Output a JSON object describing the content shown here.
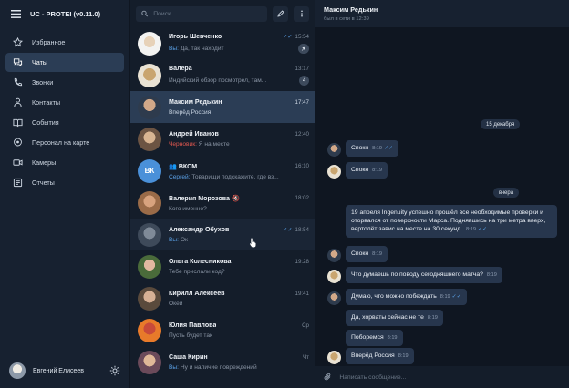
{
  "app": {
    "title": "UC - PROTEI (v0.11.0)"
  },
  "sidebar": {
    "items": [
      {
        "label": "Избранное",
        "icon": "star-icon",
        "active": false
      },
      {
        "label": "Чаты",
        "icon": "chat-icon",
        "active": true
      },
      {
        "label": "Звонки",
        "icon": "phone-icon",
        "active": false
      },
      {
        "label": "Контакты",
        "icon": "person-icon",
        "active": false
      },
      {
        "label": "События",
        "icon": "book-icon",
        "active": false
      },
      {
        "label": "Персонал на карте",
        "icon": "map-pin-icon",
        "active": false
      },
      {
        "label": "Камеры",
        "icon": "camera-icon",
        "active": false
      },
      {
        "label": "Отчеты",
        "icon": "report-icon",
        "active": false
      }
    ],
    "user": {
      "name": "Евгений Елисеев"
    }
  },
  "chatlist": {
    "search_placeholder": "Поиск",
    "chats": [
      {
        "name": "Игорь Шевченко",
        "time": "15:54",
        "prefix": "Вы:",
        "preview": "Да, так находит",
        "badge": "pin",
        "read": true
      },
      {
        "name": "Валера",
        "time": "13:17",
        "prefix": "",
        "preview": "Индийский обзор посмотрел, там...",
        "badge": "4",
        "read": false
      },
      {
        "name": "Максим Редькин",
        "time": "17:47",
        "prefix": "",
        "preview": "Вперёд Россия",
        "badge": "",
        "read": false
      },
      {
        "name": "Андрей Иванов",
        "time": "12:40",
        "prefix": "Черновик:",
        "preview": "Я на месте",
        "badge": "",
        "read": false
      },
      {
        "name": "ВКСМ",
        "time": "16:10",
        "prefix": "Сергей:",
        "preview": "Товарищи подскажите, где вз...",
        "badge": "",
        "read": false
      },
      {
        "name": "Валерия Морозова",
        "time": "18:02",
        "prefix": "",
        "preview": "Кого именно?",
        "badge": "",
        "read": false
      },
      {
        "name": "Александр Обухов",
        "time": "18:54",
        "prefix": "Вы:",
        "preview": "Ок",
        "badge": "",
        "read": true
      },
      {
        "name": "Ольга Колесникова",
        "time": "19:28",
        "prefix": "",
        "preview": "Тебе прислали код?",
        "badge": "",
        "read": false
      },
      {
        "name": "Кирилл Алексеев",
        "time": "19:41",
        "prefix": "",
        "preview": "Окей",
        "badge": "",
        "read": false
      },
      {
        "name": "Юлия Павлова",
        "time": "Ср",
        "prefix": "",
        "preview": "Пусть будет так",
        "badge": "",
        "read": false
      },
      {
        "name": "Саша Кирин",
        "time": "Чт",
        "prefix": "Вы:",
        "preview": "Ну и наличие повреждений",
        "badge": "",
        "read": false
      }
    ],
    "group_avatar_text": "ВК"
  },
  "conversation": {
    "name": "Максим Редькин",
    "status": "был в сети в 12:39",
    "dates": [
      "15 декабря",
      "вчера"
    ],
    "messages": [
      {
        "text": "Спокн",
        "time": "8:19",
        "read": true,
        "avatar": "a"
      },
      {
        "text": "Спокн",
        "time": "8:19",
        "read": false,
        "avatar": "b"
      },
      {
        "text": "19 апреля Ingenuity успешно прошёл все необходимые проверки и оторвался от поверхности Марса. Поднявшись на три метра вверх, вертолёт завис на месте на 30 секунд.",
        "time": "8:19",
        "read": true,
        "avatar": ""
      },
      {
        "text": "Спокн",
        "time": "8:19",
        "read": false,
        "avatar": "a"
      },
      {
        "text": "Что думаешь по поводу сегодняшнего матча?",
        "time": "8:19",
        "read": false,
        "avatar": "b"
      },
      {
        "text": "Думаю, что можно побеждать",
        "time": "8:19",
        "read": true,
        "avatar": "a"
      },
      {
        "text": "Да, хорваты сейчас не те",
        "time": "8:19",
        "read": false,
        "avatar": ""
      },
      {
        "text": "Поборемся",
        "time": "8:19",
        "read": false,
        "avatar": ""
      },
      {
        "text": "Вперёд Россия",
        "time": "8:19",
        "read": false,
        "avatar": "b"
      }
    ],
    "composer_placeholder": "Написать сообщение..."
  },
  "colors": {
    "accent": "#5aa0e6",
    "active": "#2b3d55",
    "draft": "#e0574f",
    "bubble": "#27364d"
  }
}
